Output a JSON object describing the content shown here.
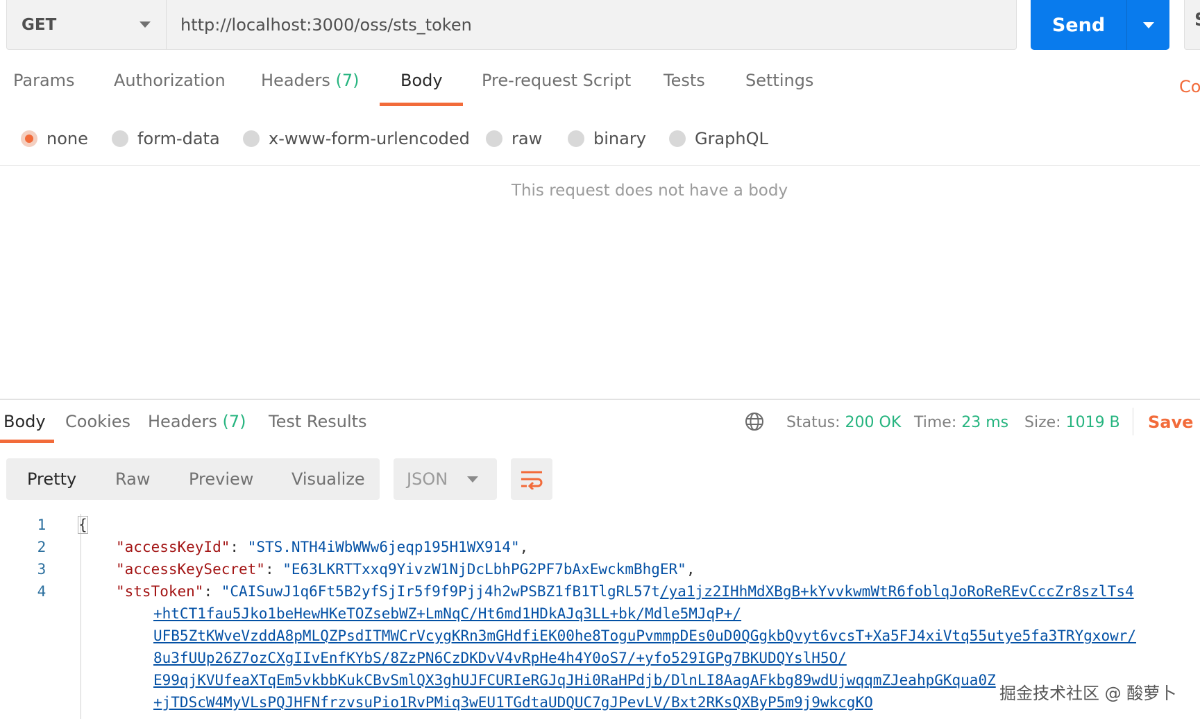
{
  "request": {
    "method": "GET",
    "url": "http://localhost:3000/oss/sts_token",
    "send_label": "Send",
    "save_label_partial": "S"
  },
  "request_tabs": [
    {
      "label": "Params"
    },
    {
      "label": "Authorization"
    },
    {
      "label": "Headers",
      "count": "(7)"
    },
    {
      "label": "Body"
    },
    {
      "label": "Pre-request Script"
    },
    {
      "label": "Tests"
    },
    {
      "label": "Settings"
    }
  ],
  "cookies_partial": "Co",
  "body_types": [
    {
      "label": "none",
      "selected": true
    },
    {
      "label": "form-data",
      "selected": false
    },
    {
      "label": "x-www-form-urlencoded",
      "selected": false
    },
    {
      "label": "raw",
      "selected": false
    },
    {
      "label": "binary",
      "selected": false
    },
    {
      "label": "GraphQL",
      "selected": false
    }
  ],
  "empty_body_message": "This request does not have a body",
  "response": {
    "tabs": [
      {
        "label": "Body"
      },
      {
        "label": "Cookies"
      },
      {
        "label": "Headers",
        "count": "(7)"
      },
      {
        "label": "Test Results"
      }
    ],
    "status_label": "Status:",
    "status_value": "200 OK",
    "time_label": "Time:",
    "time_value": "23 ms",
    "size_label": "Size:",
    "size_value": "1019 B",
    "save_label": "Save R",
    "views": [
      "Pretty",
      "Raw",
      "Preview",
      "Visualize"
    ],
    "format": "JSON"
  },
  "code": {
    "line_numbers": [
      "1",
      "2",
      "3",
      "4"
    ],
    "open_brace": "{",
    "k1": "\"accessKeyId\"",
    "v1": "\"STS.NTH4iWbWWw6jeqp195H1WX914\"",
    "k2": "\"accessKeySecret\"",
    "v2": "\"E63LKRTTxxq9YivzW1NjDcLbhPG2PF7bAxEwckmBhgER\"",
    "k3": "\"stsToken\"",
    "v3_start": "\"CAISuwJ1q6Ft5B2yfSjIr5f9f9Pjj4h2wPSBZ1fB1TlgRL57t",
    "v3_link_first": "/ya1jz2IHhMdXBgB+kYvvkwmWtR6foblqJoRoReREvCccZr8szlTs4",
    "v3_links": [
      "+htCT1fau5Jko1beHewHKeTOZsebWZ+LmNqC/Ht6md1HDkAJq3LL+bk/Mdle5MJqP+/",
      "UFB5ZtKWveVzddA8pMLQZPsdITMWCrVcygKRn3mGHdfiEK00he8ToguPvmmpDEs0uD0QGgkbQvyt6vcsT+Xa5FJ4xiVtq55utye5fa3TRYgxowr/",
      "8u3fUUp26Z7ozCXgIIvEnfKYbS/8ZzPN6CzDKDvV4vRpHe4h4Y0oS7/+yfo529IGPg7BKUDQYslH5O/",
      "E99qjKVUfeaXTqEm5vkbbKukCBvSmlQX3ghUJFCURIeRGJqJHi0RaHPdjb/DlnLI8AagAFkbg89wdUjwqqmZJeahpGKqua0Z",
      "+jTDScW4MyVLsPQJHFNfrzvsuPio1RvPMiq3wEU1TGdtaUDQUC7gJPevLV/Bxt2RKsQXByP5m9j9wkcgKO"
    ]
  },
  "watermark": "掘金技术社区 @ 酸萝卜"
}
